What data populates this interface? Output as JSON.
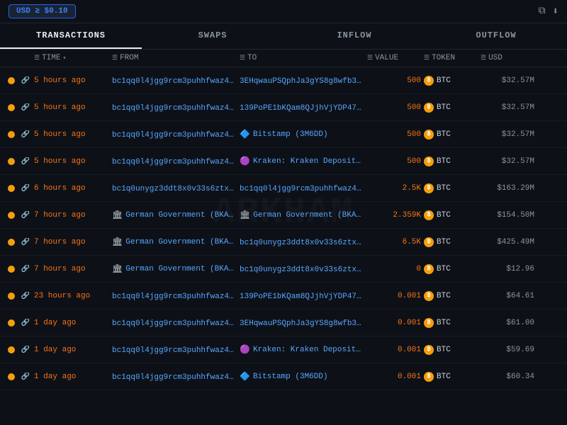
{
  "topBar": {
    "filter": "USD ≥ $0.10",
    "copyIcon": "⧉",
    "downloadIcon": "⬇"
  },
  "tabs": [
    {
      "label": "TRANSACTIONS",
      "active": true
    },
    {
      "label": "SWAPS",
      "active": false
    },
    {
      "label": "INFLOW",
      "active": false
    },
    {
      "label": "OUTFLOW",
      "active": false
    }
  ],
  "columns": [
    {
      "id": "status",
      "label": ""
    },
    {
      "id": "link",
      "label": ""
    },
    {
      "id": "time",
      "label": "TIME",
      "filterable": true,
      "sortable": true
    },
    {
      "id": "from",
      "label": "FROM",
      "filterable": true
    },
    {
      "id": "to",
      "label": "TO",
      "filterable": true
    },
    {
      "id": "value",
      "label": "VALUE",
      "filterable": true
    },
    {
      "id": "token",
      "label": "TOKEN",
      "filterable": true
    },
    {
      "id": "usd",
      "label": "USD",
      "filterable": true
    }
  ],
  "rows": [
    {
      "time": "5 hours ago",
      "from": "bc1qq0l4jgg9rcm3puhhfwaz4…",
      "to_type": "address",
      "to": "3EHqwauPSQphJa3gYS8g8wfb3…",
      "value": "500",
      "token": "BTC",
      "usd": "$32.57M"
    },
    {
      "time": "5 hours ago",
      "from": "bc1qq0l4jgg9rcm3puhhfwaz4…",
      "to_type": "address",
      "to": "139PoPE1bKQam8QJjhVjYDP47…",
      "value": "500",
      "token": "BTC",
      "usd": "$32.57M"
    },
    {
      "time": "5 hours ago",
      "from": "bc1qq0l4jgg9rcm3puhhfwaz4…",
      "to_type": "labeled",
      "to_label_icon": "🔷",
      "to": "Bitstamp (3M6DD)",
      "value": "500",
      "token": "BTC",
      "usd": "$32.57M"
    },
    {
      "time": "5 hours ago",
      "from": "bc1qq0l4jgg9rcm3puhhfwaz4…",
      "to_type": "labeled",
      "to_label_icon": "🟣",
      "to": "Kraken: Kraken Deposit …",
      "value": "500",
      "token": "BTC",
      "usd": "$32.57M"
    },
    {
      "time": "6 hours ago",
      "from": "bc1q0unygz3ddt8x0v33s6ztx…",
      "to_type": "address",
      "to": "bc1qq0l4jgg9rcm3puhhfwaz4…",
      "value": "2.5K",
      "token": "BTC",
      "usd": "$163.29M"
    },
    {
      "time": "7 hours ago",
      "from_type": "labeled",
      "from_label_icon": "🏛",
      "from": "German Government (BKA):",
      "to_type": "labeled",
      "to_label_icon": "🏛",
      "to": "German Government (BKA):",
      "value": "2.359K",
      "token": "BTC",
      "usd": "$154.50M"
    },
    {
      "time": "7 hours ago",
      "from_type": "labeled",
      "from_label_icon": "🏛",
      "from": "German Government (BKA):",
      "to_type": "address",
      "to": "bc1q0unygz3ddt8x0v33s6ztx…",
      "value": "6.5K",
      "token": "BTC",
      "usd": "$425.49M"
    },
    {
      "time": "7 hours ago",
      "from_type": "labeled",
      "from_label_icon": "🏛",
      "from": "German Government (BKA):",
      "to_type": "address",
      "to": "bc1q0unygz3ddt8x0v33s6ztx…",
      "value": "0",
      "token": "BTC",
      "usd": "$12.96"
    },
    {
      "time": "23 hours ago",
      "from": "bc1qq0l4jgg9rcm3puhhfwaz4…",
      "to_type": "address",
      "to": "139PoPE1bKQam8QJjhVjYDP47…",
      "value": "0.001",
      "token": "BTC",
      "usd": "$64.61"
    },
    {
      "time": "1 day ago",
      "from": "bc1qq0l4jgg9rcm3puhhfwaz4…",
      "to_type": "address",
      "to": "3EHqwauPSQphJa3gYS8g8wfb3…",
      "value": "0.001",
      "token": "BTC",
      "usd": "$61.00"
    },
    {
      "time": "1 day ago",
      "from": "bc1qq0l4jgg9rcm3puhhfwaz4…",
      "to_type": "labeled",
      "to_label_icon": "🟣",
      "to": "Kraken: Kraken Deposit …",
      "value": "0.001",
      "token": "BTC",
      "usd": "$59.69"
    },
    {
      "time": "1 day ago",
      "from": "bc1qq0l4jgg9rcm3puhhfwaz4…",
      "to_type": "labeled",
      "to_label_icon": "🔷",
      "to": "Bitstamp (3M6DD)",
      "value": "0.001",
      "token": "BTC",
      "usd": "$60.34"
    }
  ]
}
